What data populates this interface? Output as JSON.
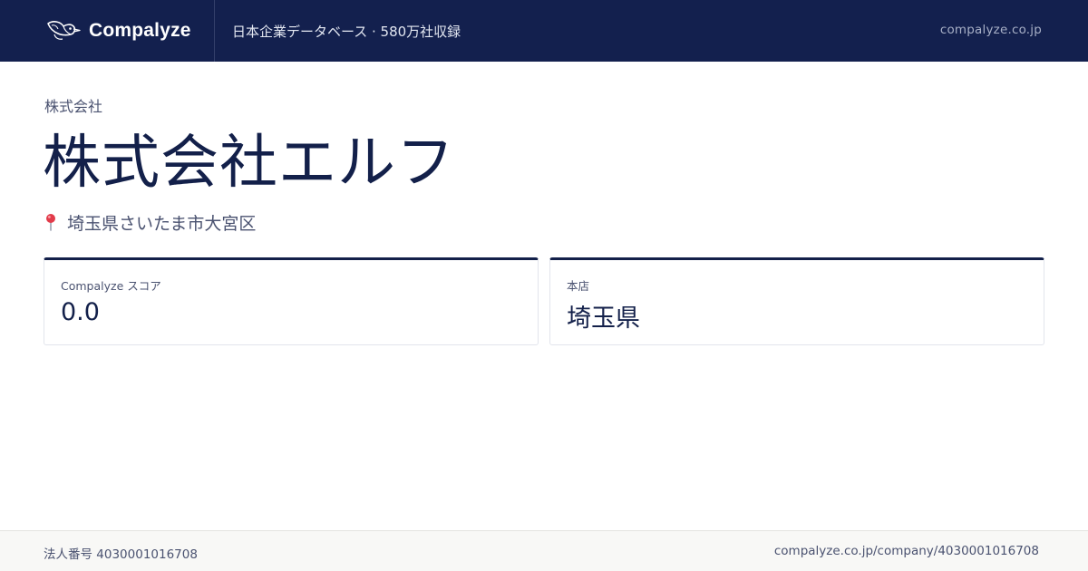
{
  "header": {
    "brand_name": "Compalyze",
    "brand_logo_icon": "duck-logo-icon",
    "tagline": "日本企業データベース · 580万社収録",
    "domain": "compalyze.co.jp"
  },
  "company": {
    "type": "株式会社",
    "name": "株式会社エルフ",
    "address_icon": "map-pin-icon",
    "address": "埼玉県さいたま市大宮区"
  },
  "cards": [
    {
      "label": "Compalyze スコア",
      "value": "0.0"
    },
    {
      "label": "本店",
      "value": "埼玉県"
    }
  ],
  "footer": {
    "corporate_number": "法人番号 4030001016708",
    "url": "compalyze.co.jp/company/4030001016708"
  },
  "colors": {
    "header_bg": "#13204e",
    "primary_text": "#13204a",
    "muted_text": "#4a5270",
    "pin_red": "#e23b4a",
    "footer_bg": "#f8f8f6"
  }
}
